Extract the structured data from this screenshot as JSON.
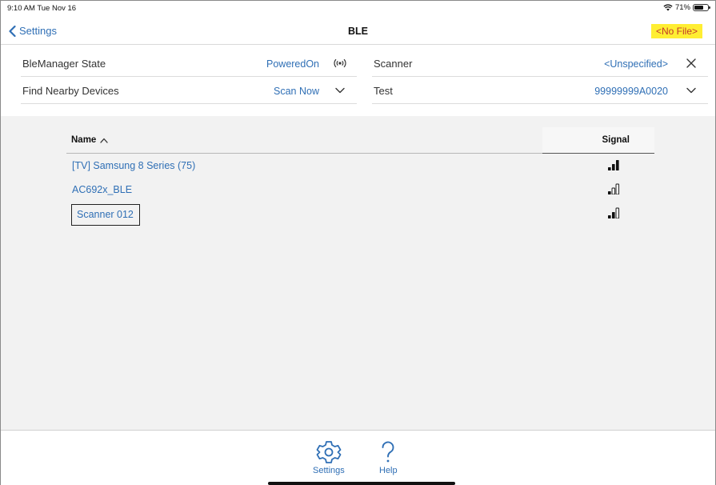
{
  "status_bar": {
    "time": "9:10 AM  Tue Nov 16",
    "battery": "71%",
    "battery_level": 0.71
  },
  "nav": {
    "back_label": "Settings",
    "title": "BLE",
    "file_label": "<No File>"
  },
  "info": {
    "ble_state_label": "BleManager State",
    "ble_state_value": "PoweredOn",
    "scanner_label": "Scanner",
    "scanner_value": "<Unspecified>",
    "find_label": "Find Nearby Devices",
    "find_value": "Scan Now",
    "test_label": "Test",
    "test_value": "99999999A0020"
  },
  "table": {
    "col_name": "Name",
    "col_signal": "Signal",
    "rows": [
      {
        "name": "[TV] Samsung 8 Series (75)",
        "signal_bars": 3
      },
      {
        "name": "AC692x_BLE",
        "signal_bars": 1
      },
      {
        "name": "Scanner 012",
        "signal_bars": 2
      }
    ]
  },
  "tabs": {
    "settings_label": "Settings",
    "help_label": "Help"
  },
  "colors": {
    "accent": "#2f6fb5",
    "file_bg": "#ffee33",
    "file_text": "#c0392b"
  }
}
